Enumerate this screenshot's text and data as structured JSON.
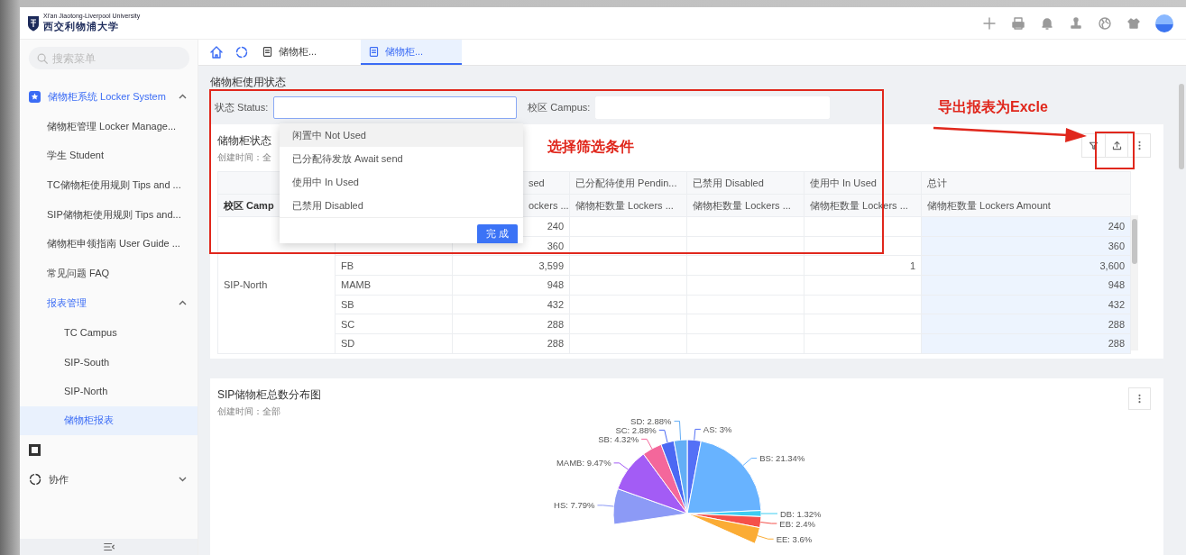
{
  "header": {
    "logo_caption": "Xi'an Jiaotong-Liverpool University",
    "logo_name": "西交利物浦大学"
  },
  "sidebar": {
    "search_placeholder": "搜索菜单",
    "menu": [
      {
        "label": "储物柜系统 Locker System",
        "expanded": true,
        "children": [
          {
            "label": "储物柜管理 Locker Manage...",
            "selected": false
          },
          {
            "label": "学生 Student",
            "selected": false
          },
          {
            "label": "TC储物柜使用规则 Tips and ...",
            "selected": false
          },
          {
            "label": "SIP储物柜使用规则 Tips and...",
            "selected": false
          },
          {
            "label": "储物柜申领指南 User Guide ...",
            "selected": false
          },
          {
            "label": "常见问题 FAQ",
            "selected": false
          },
          {
            "label": "报表管理",
            "expanded": true,
            "children": [
              {
                "label": "TC Campus",
                "selected": false
              },
              {
                "label": "SIP-South",
                "selected": false
              },
              {
                "label": "SIP-North",
                "selected": false
              },
              {
                "label": "储物柜报表",
                "selected": true
              }
            ]
          }
        ]
      },
      {
        "expanded": false
      },
      {
        "label": "协作",
        "expanded": false
      }
    ]
  },
  "tabs": [
    {
      "label": "储物柜...",
      "selected": false
    },
    {
      "label": "储物柜...",
      "selected": true
    }
  ],
  "page_title": "储物柜使用状态",
  "filters": [
    {
      "label": "状态 Status:",
      "focused": true
    },
    {
      "label": "校区 Campus:",
      "focused": false
    }
  ],
  "dropdown": {
    "options": [
      {
        "label": "闲置中 Not Used",
        "hovered": true
      },
      {
        "label": "已分配待发放 Await send",
        "hovered": false
      },
      {
        "label": "使用中 In Used",
        "hovered": false
      },
      {
        "label": "已禁用 Disabled",
        "hovered": false
      }
    ],
    "confirm": "完 成"
  },
  "table_card": {
    "title": "储物柜状态",
    "subtitle": "创建时间：全",
    "table": {
      "columns": [
        {
          "subtitle": "校区 Camp"
        },
        {},
        {
          "title": "sed",
          "subtitle": "ockers ..."
        },
        {
          "title": "已分配待使用 Pendin...",
          "subtitle": "储物柜数量 Lockers ..."
        },
        {
          "title": "已禁用 Disabled",
          "subtitle": "储物柜数量 Lockers ..."
        },
        {
          "title": "使用中 In Used",
          "subtitle": "储物柜数量 Lockers ..."
        },
        {
          "title": "总计",
          "subtitle": "储物柜数量 Lockers Amount"
        }
      ],
      "campus": "SIP-North",
      "rows": [
        {
          "not_used": "240",
          "total": "240"
        },
        {
          "not_used": "360",
          "total": "360"
        },
        {
          "building": "FB",
          "not_used": "3,599",
          "in_used": "1",
          "total": "3,600"
        },
        {
          "building": "MAMB",
          "not_used": "948",
          "total": "948"
        },
        {
          "building": "SB",
          "not_used": "432",
          "total": "432"
        },
        {
          "building": "SC",
          "not_used": "288",
          "total": "288"
        },
        {
          "building": "SD",
          "not_used": "288",
          "total": "288"
        }
      ]
    }
  },
  "chart_card": {
    "title": "SIP储物柜总数分布图",
    "subtitle": "创建时间：全部",
    "label_separator": ": ",
    "chart_data": {
      "type": "pie",
      "data_labels": true,
      "categories": [
        "AS",
        "BS",
        "DB",
        "EB",
        "EE",
        "HS",
        "MAMB",
        "SB",
        "SC",
        "SD"
      ],
      "values": [
        3,
        21.34,
        1.32,
        2.4,
        3.6,
        7.79,
        9.47,
        4.32,
        2.88,
        2.88
      ],
      "value_labels": [
        "3%",
        "21.34%",
        "1.32%",
        "2.4%",
        "3.6%",
        "7.79%",
        "9.47%",
        "4.32%",
        "2.88%",
        "2.88%"
      ]
    }
  },
  "annotations": [
    {
      "text": "选择筛选条件"
    },
    {
      "text": "导出报表为Excle"
    }
  ]
}
